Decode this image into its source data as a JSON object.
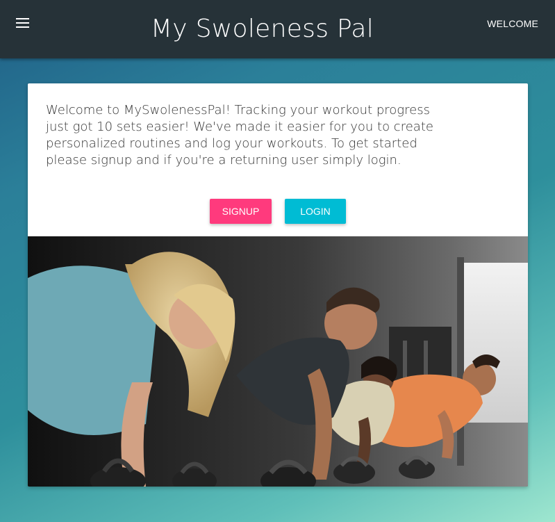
{
  "header": {
    "menu_icon": "hamburger-menu-icon",
    "title": "My Swoleness Pal",
    "nav_link": "WELCOME"
  },
  "card": {
    "text": "Welcome to MySwolenessPal! Tracking your workout progress just got 10 sets easier! We've made it easier for you to create personalized routines and log your workouts. To get started please signup and if you're a returning user simply login.",
    "signup_label": "SIGNUP",
    "login_label": "LOGIN"
  },
  "colors": {
    "appbar": "#263238",
    "signup": "#ff3a7d",
    "login": "#00bcd4"
  }
}
